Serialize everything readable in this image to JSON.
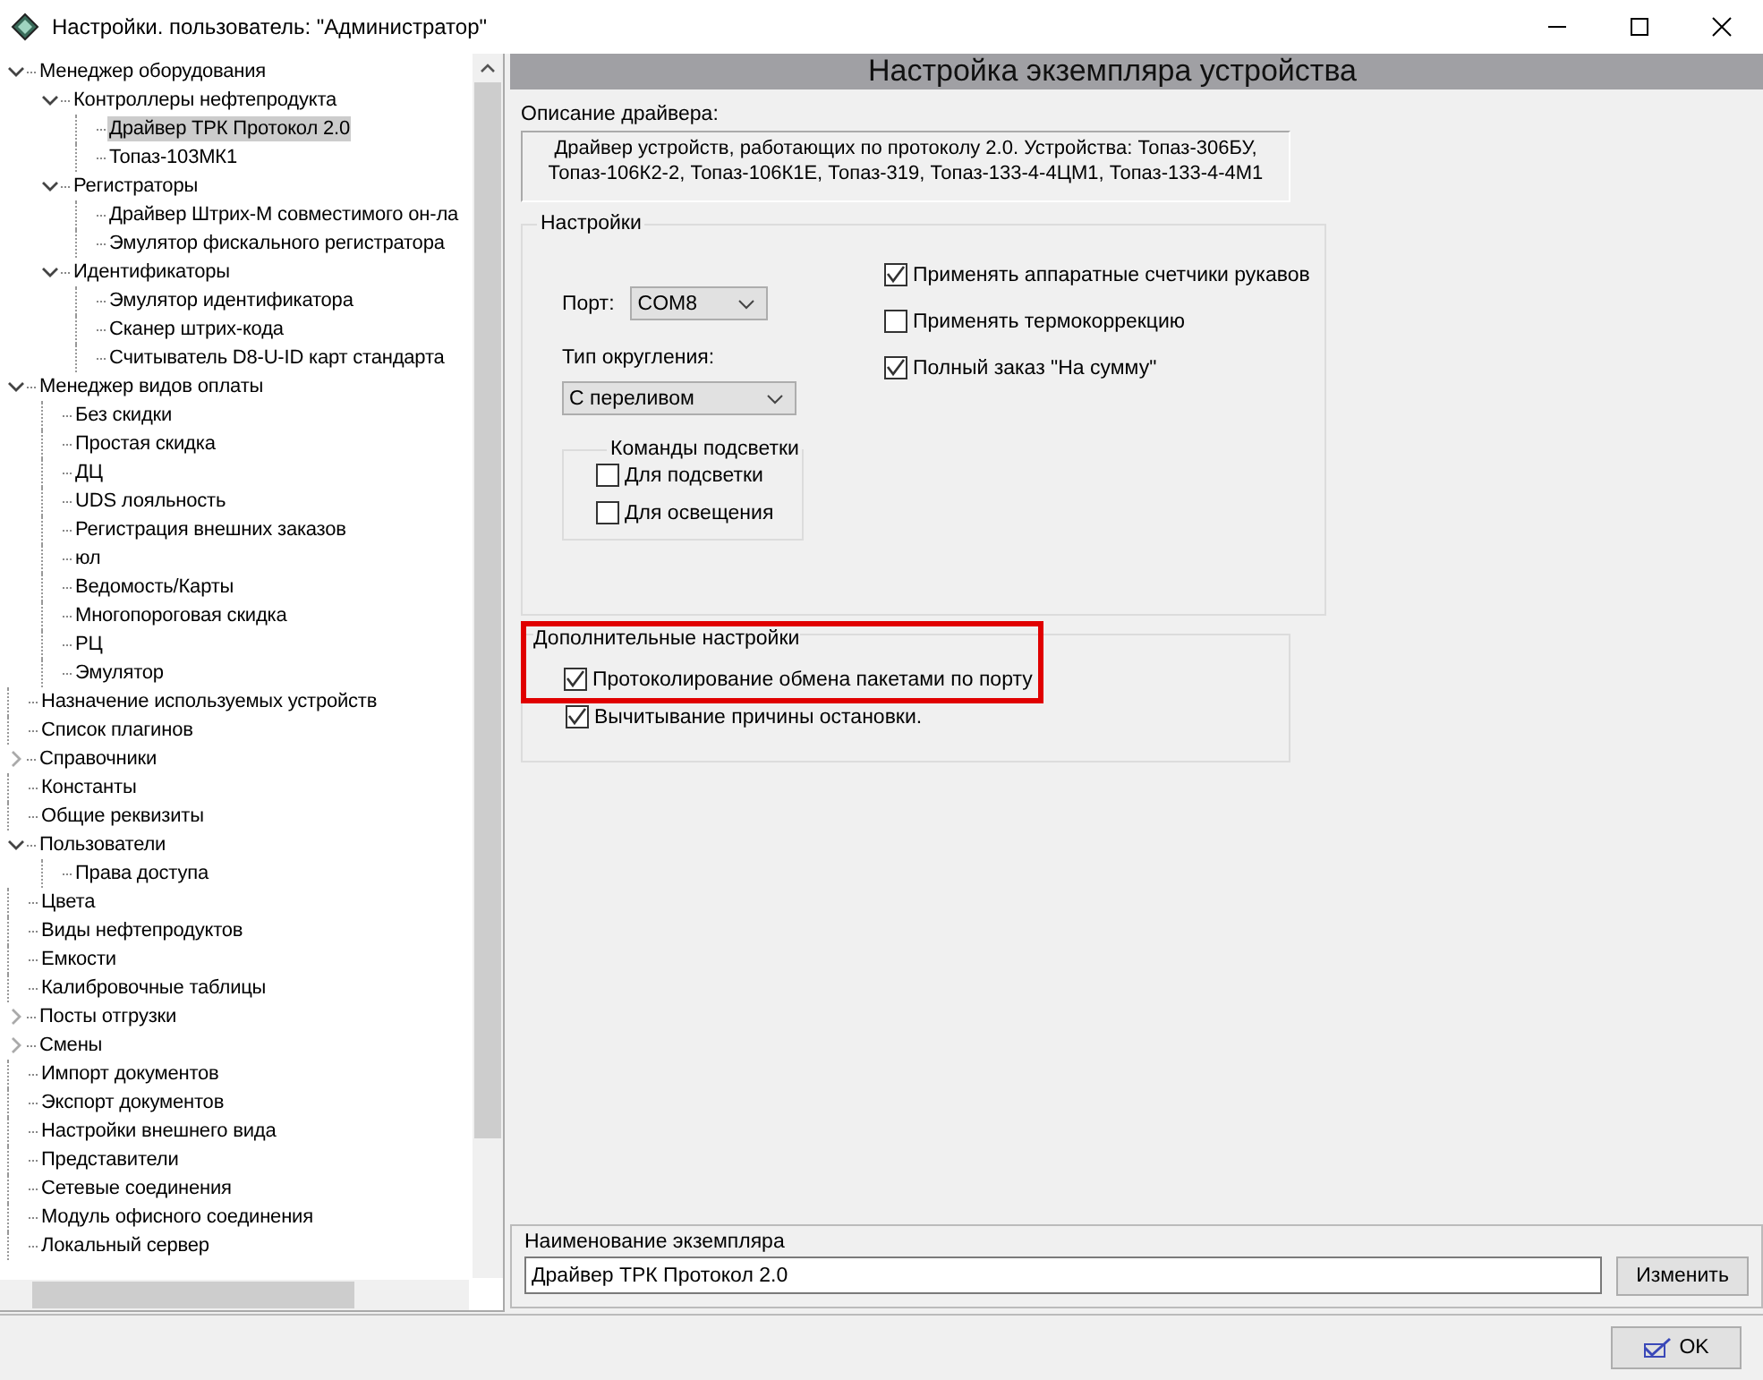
{
  "window": {
    "title": "Настройки. пользователь: \"Администратор\""
  },
  "tree": [
    {
      "label": "Менеджер оборудования",
      "expanded": true,
      "selected": false,
      "children": [
        {
          "label": "Контроллеры нефтепродукта",
          "expanded": true,
          "selected": false,
          "children": [
            {
              "label": "Драйвер ТРК Протокол 2.0",
              "selected": true
            },
            {
              "label": "Топаз-103МК1",
              "selected": false
            }
          ]
        },
        {
          "label": "Регистраторы",
          "expanded": true,
          "selected": false,
          "children": [
            {
              "label": "Драйвер Штрих-М совместимого он-ла",
              "selected": false
            },
            {
              "label": "Эмулятор фискального регистратора",
              "selected": false
            }
          ]
        },
        {
          "label": "Идентификаторы",
          "expanded": true,
          "selected": false,
          "children": [
            {
              "label": "Эмулятор идентификатора",
              "selected": false
            },
            {
              "label": "Сканер штрих-кода",
              "selected": false
            },
            {
              "label": "Считыватель D8-U-ID карт стандарта",
              "selected": false
            }
          ]
        }
      ]
    },
    {
      "label": "Менеджер видов оплаты",
      "expanded": true,
      "selected": false,
      "children": [
        {
          "label": "Без скидки",
          "selected": false
        },
        {
          "label": "Простая скидка",
          "selected": false
        },
        {
          "label": "ДЦ",
          "selected": false
        },
        {
          "label": "UDS лояльность",
          "selected": false
        },
        {
          "label": "Регистрация внешних заказов",
          "selected": false
        },
        {
          "label": "юл",
          "selected": false
        },
        {
          "label": "Ведомость/Карты",
          "selected": false
        },
        {
          "label": "Многопороговая скидка",
          "selected": false
        },
        {
          "label": "РЦ",
          "selected": false
        },
        {
          "label": "Эмулятор",
          "selected": false
        }
      ]
    },
    {
      "label": "Назначение используемых устройств",
      "selected": false
    },
    {
      "label": "Список плагинов",
      "selected": false
    },
    {
      "label": "Справочники",
      "expanded": false,
      "selected": false
    },
    {
      "label": "Константы",
      "selected": false
    },
    {
      "label": "Общие реквизиты",
      "selected": false
    },
    {
      "label": "Пользователи",
      "expanded": true,
      "selected": false,
      "children": [
        {
          "label": "Права доступа",
          "selected": false
        }
      ]
    },
    {
      "label": "Цвета",
      "selected": false
    },
    {
      "label": "Виды нефтепродуктов",
      "selected": false
    },
    {
      "label": "Емкости",
      "selected": false
    },
    {
      "label": "Калибровочные таблицы",
      "selected": false
    },
    {
      "label": "Посты отгрузки",
      "expanded": false,
      "selected": false
    },
    {
      "label": "Смены",
      "expanded": false,
      "selected": false
    },
    {
      "label": "Импорт документов",
      "selected": false
    },
    {
      "label": "Экспорт документов",
      "selected": false
    },
    {
      "label": "Настройки внешнего вида",
      "selected": false
    },
    {
      "label": "Представители",
      "selected": false
    },
    {
      "label": "Сетевые соединения",
      "selected": false
    },
    {
      "label": "Модуль офисного соединения",
      "selected": false
    },
    {
      "label": "Локальный сервер",
      "selected": false
    }
  ],
  "panel": {
    "header": "Настройка экземпляра устройства",
    "description_label": "Описание драйвера:",
    "description": "Драйвер устройств, работающих по протоколу 2.0. Устройства: Топаз-306БУ, Топаз-106К2-2, Топаз-106К1Е, Топаз-319, Топаз-133-4-4ЦМ1, Топаз-133-4-4М1",
    "settings": {
      "title": "Настройки",
      "port_label": "Порт:",
      "port": "COM8",
      "rounding_label": "Тип округления:",
      "rounding": "С переливом",
      "backlight": {
        "title": "Команды подсветки",
        "options": [
          {
            "label": "Для подсветки",
            "checked": false
          },
          {
            "label": "Для освещения",
            "checked": false
          }
        ]
      },
      "options": [
        {
          "label": "Применять аппаратные счетчики рукавов",
          "checked": true
        },
        {
          "label": "Применять термокоррекцию",
          "checked": false
        },
        {
          "label": "Полный заказ \"На сумму\"",
          "checked": true
        }
      ]
    },
    "extra": {
      "title": "Дополнительные настройки",
      "highlighted": true,
      "options": [
        {
          "label": "Протоколирование обмена пакетами по порту",
          "checked": true
        },
        {
          "label": "Вычитывание причины остановки.",
          "checked": true
        }
      ]
    },
    "name_panel": {
      "label": "Наименование экземпляра",
      "value": "Драйвер ТРК Протокол 2.0",
      "button": "Изменить"
    }
  },
  "footer": {
    "ok": "OK"
  }
}
